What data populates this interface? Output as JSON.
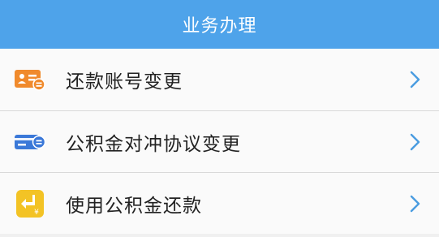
{
  "header": {
    "title": "业务办理",
    "background_color": "#4ea3ea"
  },
  "items": [
    {
      "label": "还款账号变更",
      "icon": "account-card-icon",
      "icon_color": "#f08a2c"
    },
    {
      "label": "公积金对冲协议变更",
      "icon": "card-swap-icon",
      "icon_color": "#3a78d8"
    },
    {
      "label": "使用公积金还款",
      "icon": "yuan-return-icon",
      "icon_color": "#f3c325"
    }
  ],
  "chevron_color": "#4a9ce0"
}
